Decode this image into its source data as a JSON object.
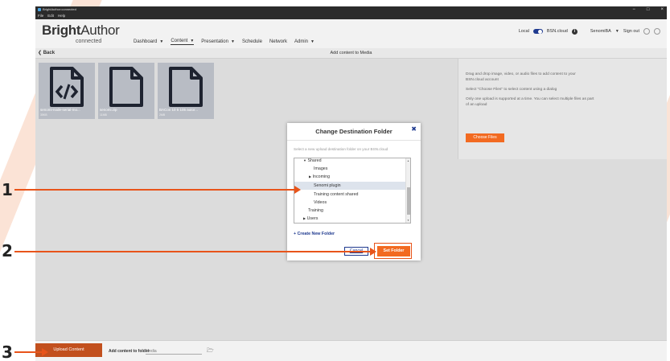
{
  "window": {
    "title": "BrightAuthor:connected",
    "controls": [
      "−",
      "□",
      "×"
    ]
  },
  "menubar": [
    "File",
    "Edit",
    "Help"
  ],
  "brand": {
    "name_bold": "Bright",
    "name_thin": "Author",
    "sub": "connected"
  },
  "nav": [
    {
      "label": "Dashboard",
      "caret": true,
      "active": false
    },
    {
      "label": "Content",
      "caret": true,
      "active": true
    },
    {
      "label": "Presentation",
      "caret": true,
      "active": false
    },
    {
      "label": "Schedule",
      "caret": false,
      "active": false
    },
    {
      "label": "Network",
      "caret": false,
      "active": false
    },
    {
      "label": "Admin",
      "caret": true,
      "active": false
    }
  ],
  "header_right": {
    "local": "Local",
    "bsn": "BSN.cloud",
    "user": "SenomiBA",
    "signout": "Sign out"
  },
  "subbar": {
    "back": "Back",
    "title": "Add content to Media"
  },
  "tiles": [
    {
      "name": "senomi-node-serial-mo...",
      "size": "35KB",
      "icon": "code-file-icon"
    },
    {
      "name": "senomi.zip",
      "size": "11MB",
      "icon": "file-icon"
    },
    {
      "name": "BACon 10 5 105 autor...",
      "size": "2MB",
      "icon": "file-icon"
    }
  ],
  "info_panel": {
    "p1": "Drag and drop image, video, or audio files to add content to your BSN.cloud account",
    "p2": "Select \"Choose Files\" to select content using a dialog",
    "p3": "Only one upload is supported at a time. You can select multiple files as part of an upload",
    "choose_files": "Choose Files"
  },
  "modal": {
    "title": "Change Destination Folder",
    "close": "✖",
    "description": "Select a new upload destination folder on your BSN.cloud",
    "tree": [
      {
        "label": "Shared",
        "indent": 1,
        "tri": "▼",
        "selected": false
      },
      {
        "label": "Images",
        "indent": 2,
        "tri": "",
        "selected": false
      },
      {
        "label": "Incoming",
        "indent": 2,
        "tri": "▶",
        "selected": false
      },
      {
        "label": "Senomi plugin",
        "indent": 2,
        "tri": "",
        "selected": true
      },
      {
        "label": "Training content shared",
        "indent": 2,
        "tri": "",
        "selected": false
      },
      {
        "label": "Videos",
        "indent": 2,
        "tri": "",
        "selected": false
      },
      {
        "label": "Training",
        "indent": 1,
        "tri": "",
        "selected": false
      },
      {
        "label": "Users",
        "indent": 1,
        "tri": "▶",
        "selected": false
      }
    ],
    "create_folder": "+ Create New Folder",
    "cancel": "Cancel",
    "set_folder": "Set Folder"
  },
  "footer": {
    "upload_content": "Upload Content",
    "folder_label": "Add content to folder",
    "folder_value": "Media"
  },
  "callouts": [
    "1",
    "2",
    "3"
  ],
  "colors": {
    "accent": "#f26a21",
    "callout": "#e8541a",
    "brand_blue": "#1f3a8f"
  }
}
